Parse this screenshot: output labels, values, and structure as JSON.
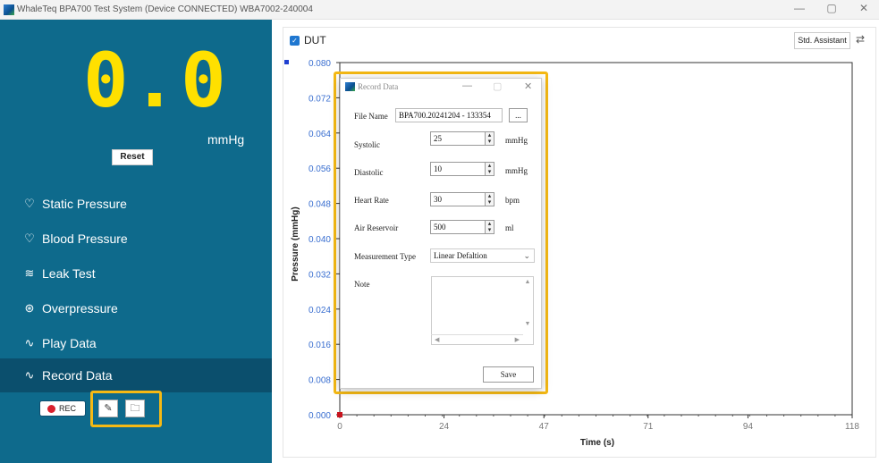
{
  "window": {
    "title": "WhaleTeq BPA700 Test System (Device CONNECTED)   WBA7002-240004",
    "minimize": "—",
    "restore": "▢",
    "close": "✕"
  },
  "gauge": {
    "value": "0.0",
    "unit": "mmHg",
    "reset_label": "Reset"
  },
  "sidebar": {
    "items": [
      {
        "label": "Static Pressure",
        "icon": "heart-outline-icon",
        "glyph": "♡"
      },
      {
        "label": "Blood Pressure",
        "icon": "heart-pulse-icon",
        "glyph": "♡"
      },
      {
        "label": "Leak Test",
        "icon": "leak-icon",
        "glyph": "≋"
      },
      {
        "label": "Overpressure",
        "icon": "gauge-icon",
        "glyph": "⊛"
      },
      {
        "label": "Play Data",
        "icon": "play-wave-icon",
        "glyph": "∿"
      },
      {
        "label": "Record Data",
        "icon": "record-wave-icon",
        "glyph": "∿"
      }
    ],
    "active_item": "Record Data",
    "rec_label": "REC",
    "edit_glyph": "✎",
    "folder_glyph": "🗀"
  },
  "toolbar": {
    "dut_label": "DUT",
    "dut_checked": true,
    "std_assistant_label": "Std. Assistant",
    "settings_glyph": "⇄"
  },
  "chart_data": {
    "type": "line",
    "title": "",
    "xlabel": "Time (s)",
    "ylabel": "Pressure (mmHg)",
    "x_ticks": [
      "0",
      "24",
      "47",
      "71",
      "94",
      "118"
    ],
    "y_ticks": [
      "0.000",
      "0.008",
      "0.016",
      "0.024",
      "0.032",
      "0.040",
      "0.048",
      "0.056",
      "0.064",
      "0.072",
      "0.080"
    ],
    "xlim": [
      0,
      118
    ],
    "ylim": [
      0,
      0.08
    ],
    "series": [
      {
        "name": "DUT",
        "color": "#1f3fd0",
        "x": [
          0
        ],
        "y": [
          0
        ]
      }
    ]
  },
  "dialog": {
    "title": "Record Data",
    "file_name_label": "File Name",
    "file_name_value": "BPA700.20241204 - 133354",
    "browse_label": "...",
    "systolic_label": "Systolic",
    "systolic_value": "25",
    "systolic_unit": "mmHg",
    "diastolic_label": "Diastolic",
    "diastolic_value": "10",
    "diastolic_unit": "mmHg",
    "heart_rate_label": "Heart Rate",
    "heart_rate_value": "30",
    "heart_rate_unit": "bpm",
    "air_reservoir_label": "Air Reservoir",
    "air_reservoir_value": "500",
    "air_reservoir_unit": "ml",
    "measurement_type_label": "Measurement Type",
    "measurement_type_value": "Linear Defaltion",
    "note_label": "Note",
    "note_value": "",
    "save_label": "Save"
  },
  "colors": {
    "sidebar_bg": "#0e6a8c",
    "active_item_bg": "#0b4f6d",
    "gauge_value": "#ffe000",
    "highlight": "#f5b914",
    "axis_tick_label": "#3a6fd0"
  }
}
